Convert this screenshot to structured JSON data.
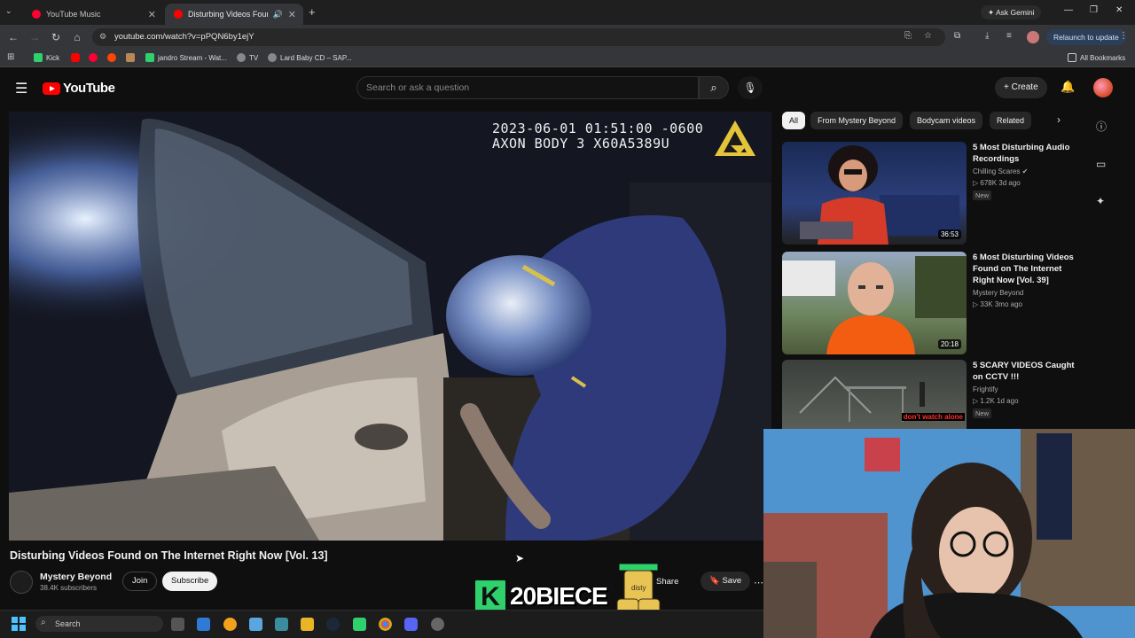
{
  "browser": {
    "tabs": [
      {
        "label": "YouTube Music",
        "active": false
      },
      {
        "label": "Disturbing Videos Found o",
        "active": true
      }
    ],
    "ask_gemini": "Ask Gemini",
    "url": "youtube.com/watch?v=pPQN6by1ejY",
    "relaunch": "Relaunch to update",
    "bookmarks": [
      "Kick",
      "jandro Stream - Wat...",
      "TV",
      "Lard Baby CD – SAP..."
    ],
    "all_bookmarks": "All Bookmarks"
  },
  "youtube": {
    "logo": "YouTube",
    "search_placeholder": "Search or ask a question",
    "create": "Create"
  },
  "video": {
    "osd_line1": "2023-06-01 01:51:00 -0600",
    "osd_line2": "AXON BODY 3 X60A5389U",
    "title": "Disturbing Videos Found on The Internet Right Now [Vol. 13]",
    "channel": "Mystery Beyond",
    "subscribers": "38.4K subscribers",
    "join": "Join",
    "subscribe": "Subscribe",
    "share": "Share",
    "save": "Save"
  },
  "chips": [
    "All",
    "From Mystery Beyond",
    "Bodycam videos",
    "Related"
  ],
  "recommendations": [
    {
      "title": "5 Most Disturbing Audio Recordings",
      "channel": "Chilling Scares",
      "stats": "678K  3d ago",
      "badge": "New",
      "duration": "36:53"
    },
    {
      "title": "6 Most Disturbing Videos Found on The Internet Right Now [Vol. 39]",
      "channel": "Mystery Beyond",
      "stats": "33K  3mo ago",
      "badge": "",
      "duration": "20:18"
    },
    {
      "title": "5 SCARY VIDEOS Caught on CCTV !!!",
      "channel": "Frightify",
      "stats": "1.2K  1d ago",
      "badge": "New",
      "duration": "",
      "thumb_text": "don't watch alone"
    }
  ],
  "overlay": {
    "kick_name": "20BIECE",
    "can_text": "disty"
  },
  "taskbar": {
    "search": "Search"
  },
  "colors": {
    "youtube_red": "#ff0000",
    "kick_green": "#2ed16b",
    "background": "#0f0f0f"
  },
  "icons": [
    "menu-icon",
    "search-icon",
    "mic-icon",
    "bell-icon",
    "info-icon",
    "chat-icon",
    "sparkle-icon",
    "chevron-right-icon",
    "share-icon",
    "bookmark-icon",
    "windows-icon"
  ]
}
